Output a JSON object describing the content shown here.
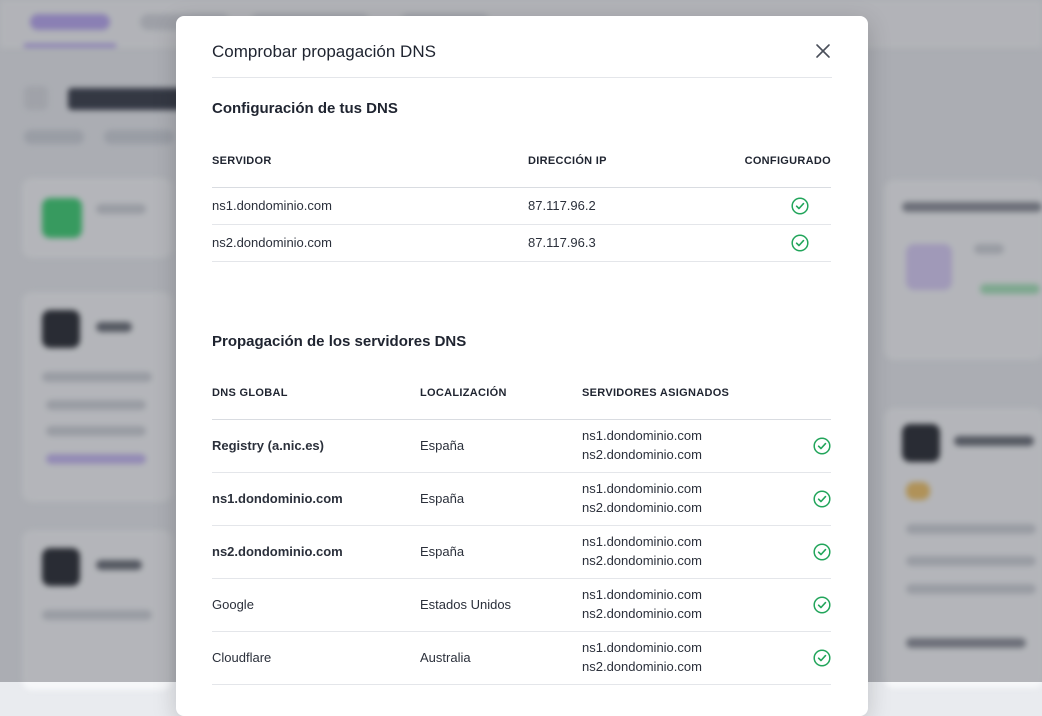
{
  "modal": {
    "title": "Comprobar propagación DNS",
    "close_icon": "close-icon"
  },
  "dns_config": {
    "title": "Configuración de tus DNS",
    "columns": [
      "SERVIDOR",
      "DIRECCIÓN IP",
      "CONFIGURADO"
    ],
    "rows": [
      {
        "server": "ns1.dondominio.com",
        "ip": "87.117.96.2",
        "configured": true
      },
      {
        "server": "ns2.dondominio.com",
        "ip": "87.117.96.3",
        "configured": true
      }
    ]
  },
  "propagation": {
    "title": "Propagación de los servidores DNS",
    "columns": [
      "DNS GLOBAL",
      "LOCALIZACIÓN",
      "SERVIDORES ASIGNADOS"
    ],
    "rows": [
      {
        "dns": "Registry (a.nic.es)",
        "bold": true,
        "location": "España",
        "servers": [
          "ns1.dondominio.com",
          "ns2.dondominio.com"
        ],
        "ok": true
      },
      {
        "dns": "ns1.dondominio.com",
        "bold": true,
        "location": "España",
        "servers": [
          "ns1.dondominio.com",
          "ns2.dondominio.com"
        ],
        "ok": true
      },
      {
        "dns": "ns2.dondominio.com",
        "bold": true,
        "location": "España",
        "servers": [
          "ns1.dondominio.com",
          "ns2.dondominio.com"
        ],
        "ok": true
      },
      {
        "dns": "Google",
        "bold": false,
        "location": "Estados Unidos",
        "servers": [
          "ns1.dondominio.com",
          "ns2.dondominio.com"
        ],
        "ok": true
      },
      {
        "dns": "Cloudflare",
        "bold": false,
        "location": "Australia",
        "servers": [
          "ns1.dondominio.com",
          "ns2.dondominio.com"
        ],
        "ok": true
      }
    ]
  },
  "colors": {
    "check_green": "#22a55b",
    "overlay": "rgba(40,44,54,0.32)"
  }
}
